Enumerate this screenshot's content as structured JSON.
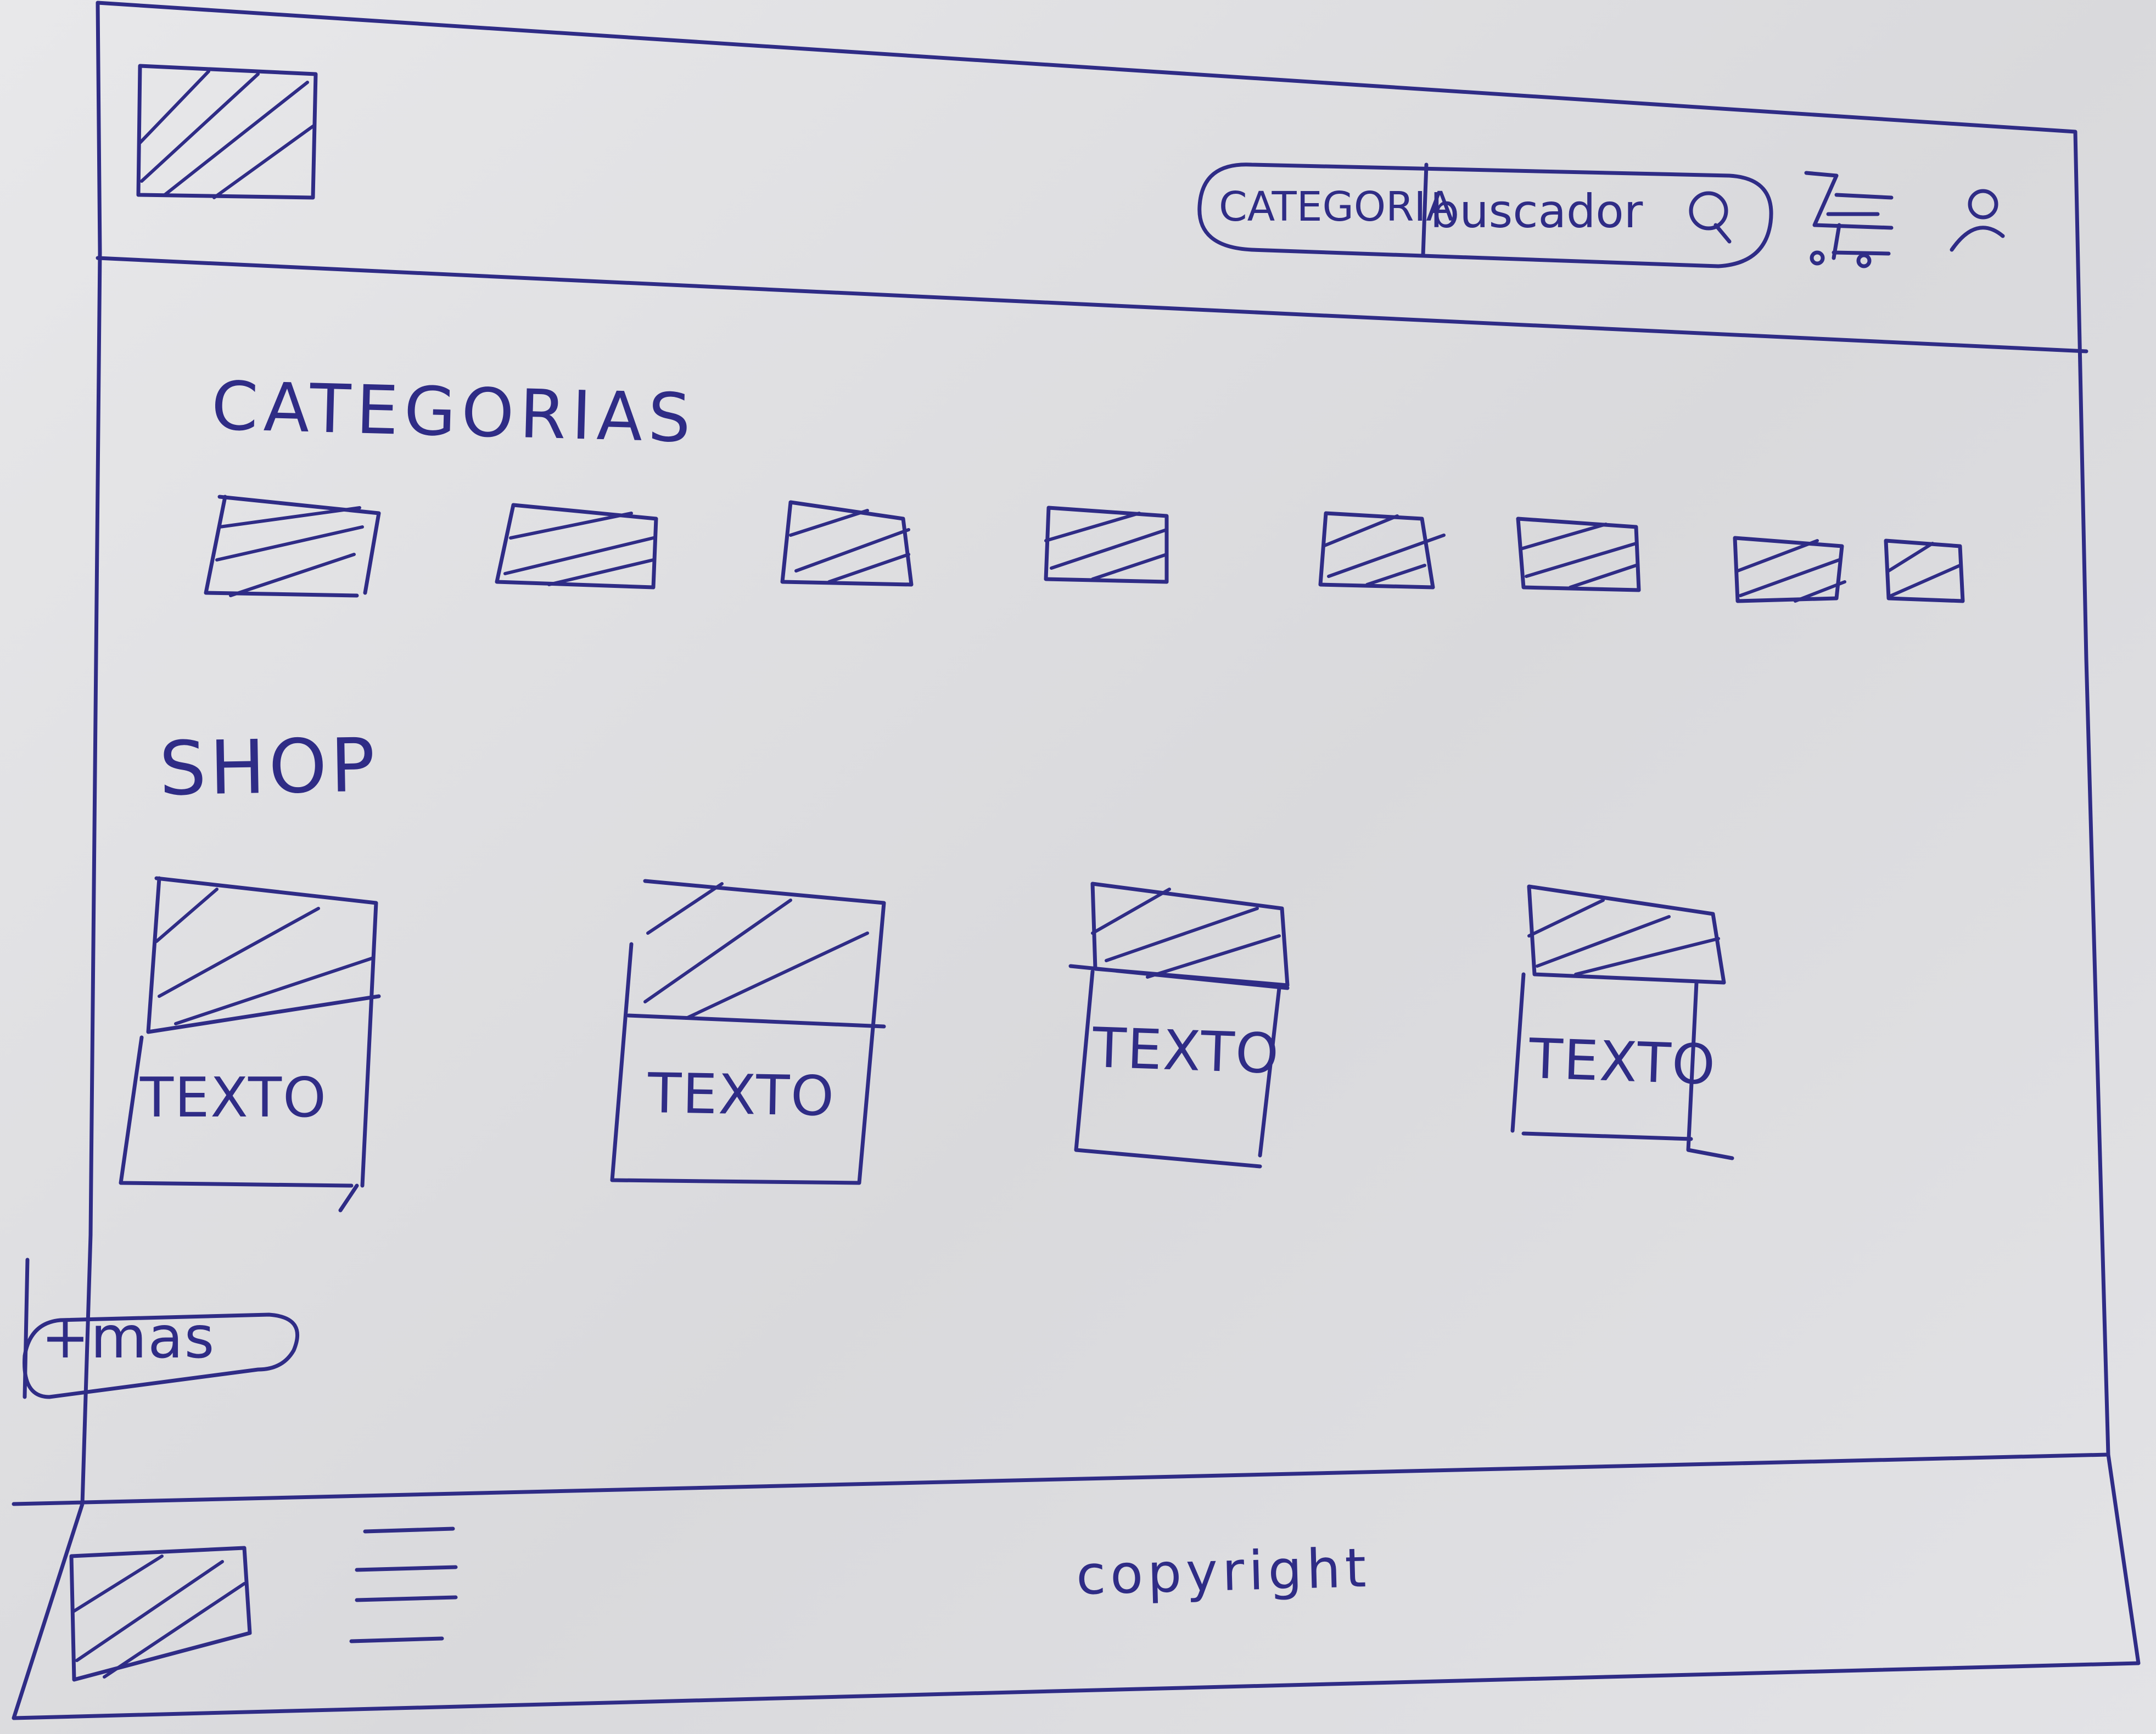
{
  "header": {
    "logo": "hatched-image-placeholder",
    "search": {
      "category_label": "CATEGORIA",
      "placeholder": "buscador"
    },
    "icons": [
      "search-icon",
      "cart-icon",
      "user-icon"
    ]
  },
  "categories": {
    "title": "CATEGORIAS",
    "items": [
      "category-image-placeholder",
      "category-image-placeholder",
      "category-image-placeholder",
      "category-image-placeholder",
      "category-image-placeholder",
      "category-image-placeholder",
      "category-image-placeholder",
      "category-image-placeholder"
    ]
  },
  "shop": {
    "title": "SHOP",
    "products": [
      {
        "text": "TEXTO"
      },
      {
        "text": "TEXTO"
      },
      {
        "text": "TEXTO"
      },
      {
        "text": "TEXTO"
      }
    ],
    "more_button": "+mas"
  },
  "footer": {
    "logo": "hatched-image-placeholder",
    "menu_icon": "hamburger-menu-icon",
    "copyright": "copyright"
  }
}
